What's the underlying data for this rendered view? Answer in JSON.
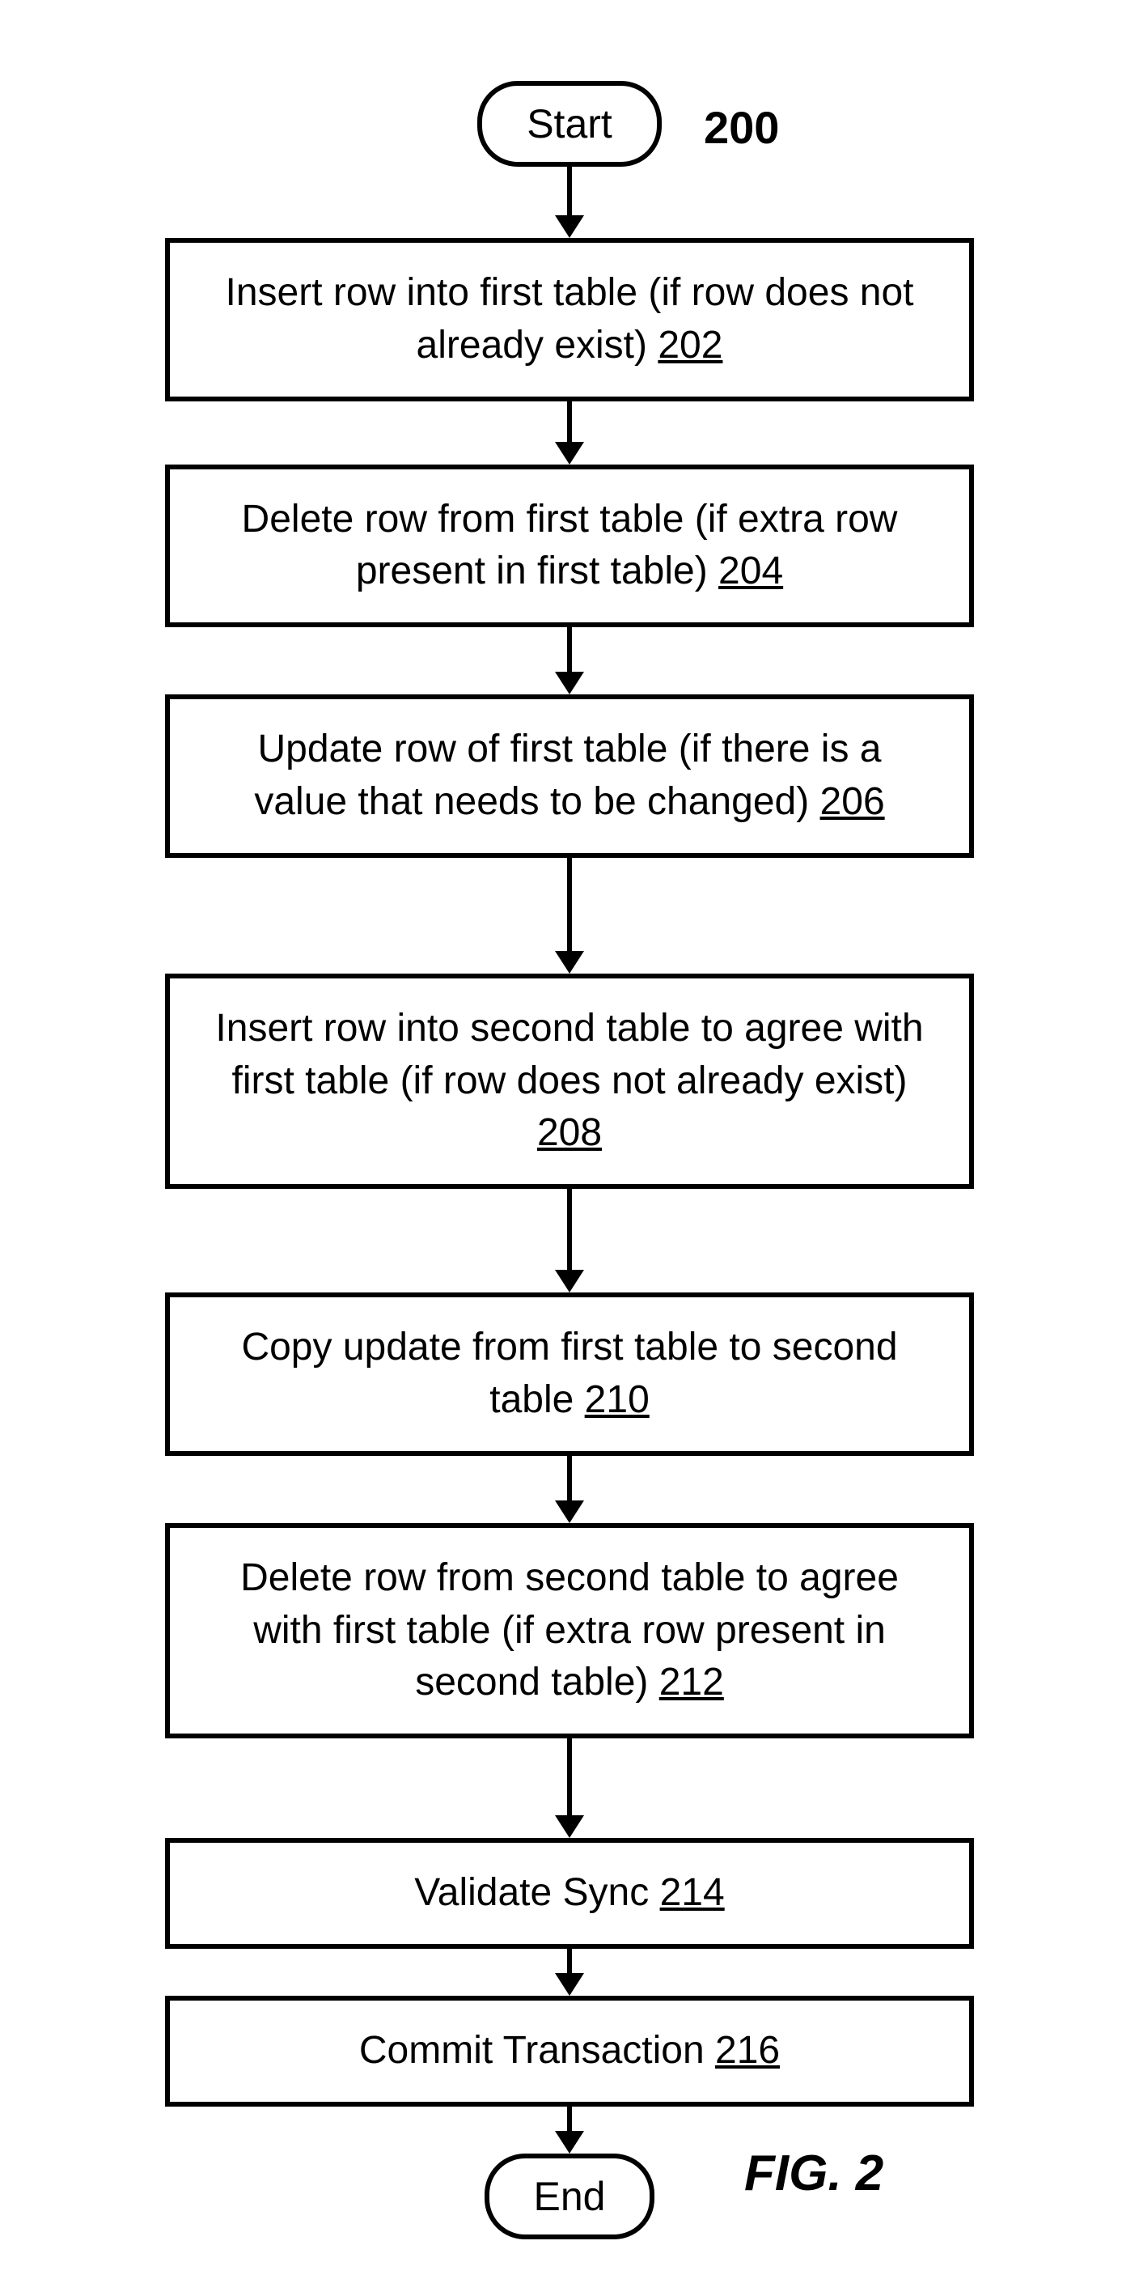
{
  "diagram_ref": "200",
  "figure_label": "FIG. 2",
  "start": "Start",
  "end": "End",
  "steps": [
    {
      "text": "Insert row into first table (if row does not already exist)",
      "ref": "202"
    },
    {
      "text": "Delete row from first table (if extra row present in first table)",
      "ref": "204"
    },
    {
      "text": "Update row of first table (if there is a value that needs to be changed)",
      "ref": "206"
    },
    {
      "text": "Insert row into second table to agree with first table (if row does not already exist)",
      "ref": "208"
    },
    {
      "text": "Copy update from first table to second table",
      "ref": "210"
    },
    {
      "text": "Delete row from second table to agree with first table (if extra row present in second table)",
      "ref": "212"
    },
    {
      "text": "Validate Sync",
      "ref": "214"
    },
    {
      "text": "Commit Transaction",
      "ref": "216"
    }
  ],
  "arrow_heights": [
    60,
    50,
    55,
    115,
    100,
    55,
    95,
    30,
    30,
    40
  ]
}
